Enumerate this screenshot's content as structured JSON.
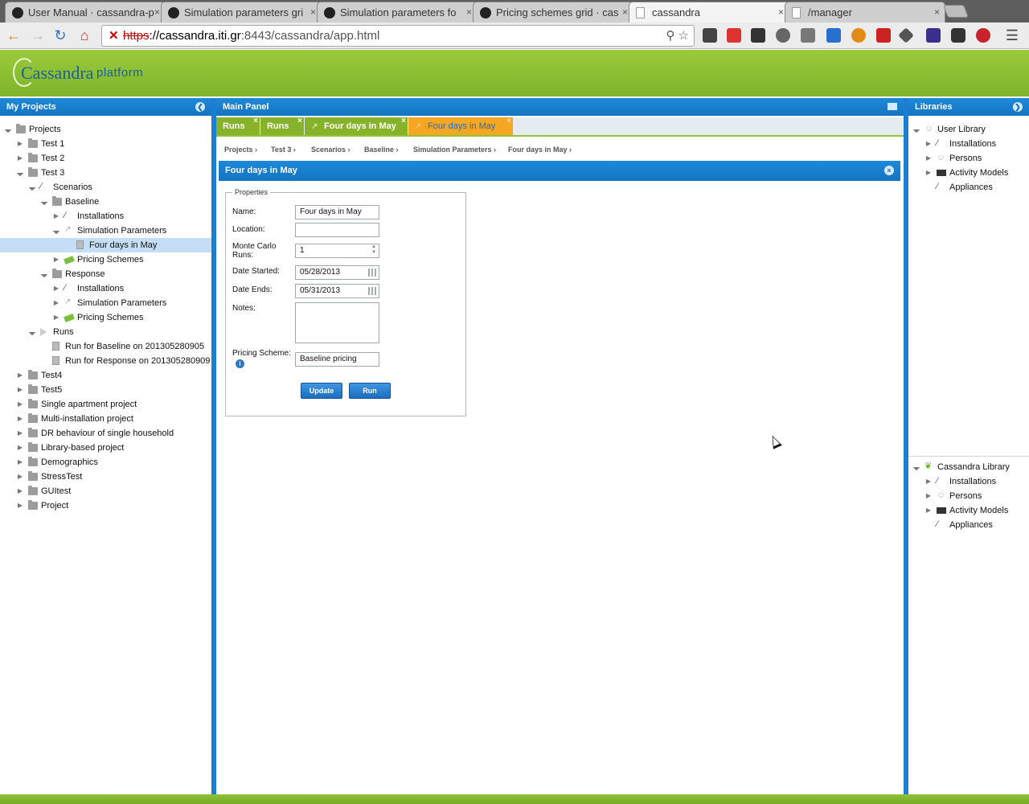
{
  "browser": {
    "tabs": [
      {
        "label": "User Manual · cassandra-p",
        "icon": "github-icon",
        "active": false
      },
      {
        "label": "Simulation parameters gri",
        "icon": "github-icon",
        "active": false
      },
      {
        "label": "Simulation parameters fo",
        "icon": "github-icon",
        "active": false
      },
      {
        "label": "Pricing schemes grid · cas",
        "icon": "github-icon",
        "active": false
      },
      {
        "label": "cassandra",
        "icon": "page-icon",
        "active": true
      },
      {
        "label": "/manager",
        "icon": "page-icon",
        "active": false
      }
    ],
    "url_scheme": "https",
    "url_host": "://cassandra.iti.gr",
    "url_rest": ":8443/cassandra/app.html"
  },
  "app": {
    "logo_text": "Cassandra",
    "platform_text": "platform"
  },
  "left_panel": {
    "title": "My Projects",
    "tree": [
      {
        "label": "Projects",
        "depth": 0,
        "toggle": "open",
        "icon": "projects-icon"
      },
      {
        "label": "Test 1",
        "depth": 1,
        "toggle": "closed",
        "icon": "folder-icon"
      },
      {
        "label": "Test 2",
        "depth": 1,
        "toggle": "closed",
        "icon": "folder-icon"
      },
      {
        "label": "Test 3",
        "depth": 1,
        "toggle": "open",
        "icon": "folder-icon"
      },
      {
        "label": "Scenarios",
        "depth": 2,
        "toggle": "open",
        "icon": "scenarios-icon"
      },
      {
        "label": "Baseline",
        "depth": 3,
        "toggle": "open",
        "icon": "folder-icon"
      },
      {
        "label": "Installations",
        "depth": 4,
        "toggle": "closed",
        "icon": "wrench-icon"
      },
      {
        "label": "Simulation Parameters",
        "depth": 4,
        "toggle": "open",
        "icon": "chart-icon"
      },
      {
        "label": "Four days in May",
        "depth": 5,
        "toggle": "none",
        "icon": "document-icon",
        "selected": true
      },
      {
        "label": "Pricing Schemes",
        "depth": 4,
        "toggle": "closed",
        "icon": "money-icon"
      },
      {
        "label": "Response",
        "depth": 3,
        "toggle": "open",
        "icon": "folder-icon"
      },
      {
        "label": "Installations",
        "depth": 4,
        "toggle": "closed",
        "icon": "wrench-icon"
      },
      {
        "label": "Simulation Parameters",
        "depth": 4,
        "toggle": "closed",
        "icon": "chart-icon"
      },
      {
        "label": "Pricing Schemes",
        "depth": 4,
        "toggle": "closed",
        "icon": "money-icon"
      },
      {
        "label": "Runs",
        "depth": 2,
        "toggle": "open",
        "icon": "play-icon"
      },
      {
        "label": "Run for Baseline on 201305280905",
        "depth": 3,
        "toggle": "none",
        "icon": "document-icon"
      },
      {
        "label": "Run for Response on 201305280909",
        "depth": 3,
        "toggle": "none",
        "icon": "document-icon"
      },
      {
        "label": "Test4",
        "depth": 1,
        "toggle": "closed",
        "icon": "folder-icon"
      },
      {
        "label": "Test5",
        "depth": 1,
        "toggle": "closed",
        "icon": "folder-icon"
      },
      {
        "label": "Single apartment project",
        "depth": 1,
        "toggle": "closed",
        "icon": "folder-icon"
      },
      {
        "label": "Multi-installation project",
        "depth": 1,
        "toggle": "closed",
        "icon": "folder-icon"
      },
      {
        "label": "DR behaviour of single household",
        "depth": 1,
        "toggle": "closed",
        "icon": "folder-icon"
      },
      {
        "label": "Library-based project",
        "depth": 1,
        "toggle": "closed",
        "icon": "folder-icon"
      },
      {
        "label": "Demographics",
        "depth": 1,
        "toggle": "closed",
        "icon": "folder-icon"
      },
      {
        "label": "StressTest",
        "depth": 1,
        "toggle": "closed",
        "icon": "folder-icon"
      },
      {
        "label": "GUItest",
        "depth": 1,
        "toggle": "closed",
        "icon": "folder-icon"
      },
      {
        "label": "Project",
        "depth": 1,
        "toggle": "closed",
        "icon": "folder-icon"
      }
    ]
  },
  "main_panel": {
    "title": "Main Panel",
    "tabs": [
      {
        "label": "Runs",
        "icon": "",
        "active": false
      },
      {
        "label": "Runs",
        "icon": "",
        "active": false
      },
      {
        "label": "Four days in May",
        "icon": "chart-icon",
        "active": false
      },
      {
        "label": "Four days in May",
        "icon": "chart-icon",
        "active": true
      }
    ],
    "breadcrumb": [
      "Projects",
      "Test 3",
      "Scenarios",
      "Baseline",
      "Simulation Parameters",
      "Four days in May"
    ],
    "form": {
      "title": "Four days in May",
      "legend": "Properties",
      "fields": {
        "name_label": "Name:",
        "name_value": "Four days in May",
        "location_label": "Location:",
        "location_value": "",
        "mc_label_1": "Monte Carlo",
        "mc_label_2": "Runs:",
        "mc_value": "1",
        "date_started_label": "Date Started:",
        "date_started_value": "05/28/2013",
        "date_ends_label": "Date Ends:",
        "date_ends_value": "05/31/2013",
        "notes_label": "Notes:",
        "notes_value": "",
        "pricing_label": "Pricing Scheme:",
        "pricing_value": "Baseline pricing"
      },
      "update_label": "Update",
      "run_label": "Run"
    }
  },
  "right_panel": {
    "title": "Libraries",
    "user_library": [
      {
        "label": "User Library",
        "depth": 0,
        "toggle": "open",
        "icon": "user-icon"
      },
      {
        "label": "Installations",
        "depth": 1,
        "toggle": "closed",
        "icon": "wrench-icon"
      },
      {
        "label": "Persons",
        "depth": 1,
        "toggle": "closed",
        "icon": "person-icon"
      },
      {
        "label": "Activity Models",
        "depth": 1,
        "toggle": "closed",
        "icon": "tv-icon"
      },
      {
        "label": "Appliances",
        "depth": 1,
        "toggle": "none",
        "icon": "appliance-icon"
      }
    ],
    "cassandra_library": [
      {
        "label": "Cassandra Library",
        "depth": 0,
        "toggle": "open",
        "icon": "leaf-icon"
      },
      {
        "label": "Installations",
        "depth": 1,
        "toggle": "closed",
        "icon": "wrench-icon"
      },
      {
        "label": "Persons",
        "depth": 1,
        "toggle": "closed",
        "icon": "person-icon"
      },
      {
        "label": "Activity Models",
        "depth": 1,
        "toggle": "closed",
        "icon": "tv-icon"
      },
      {
        "label": "Appliances",
        "depth": 1,
        "toggle": "none",
        "icon": "appliance-icon"
      }
    ]
  }
}
